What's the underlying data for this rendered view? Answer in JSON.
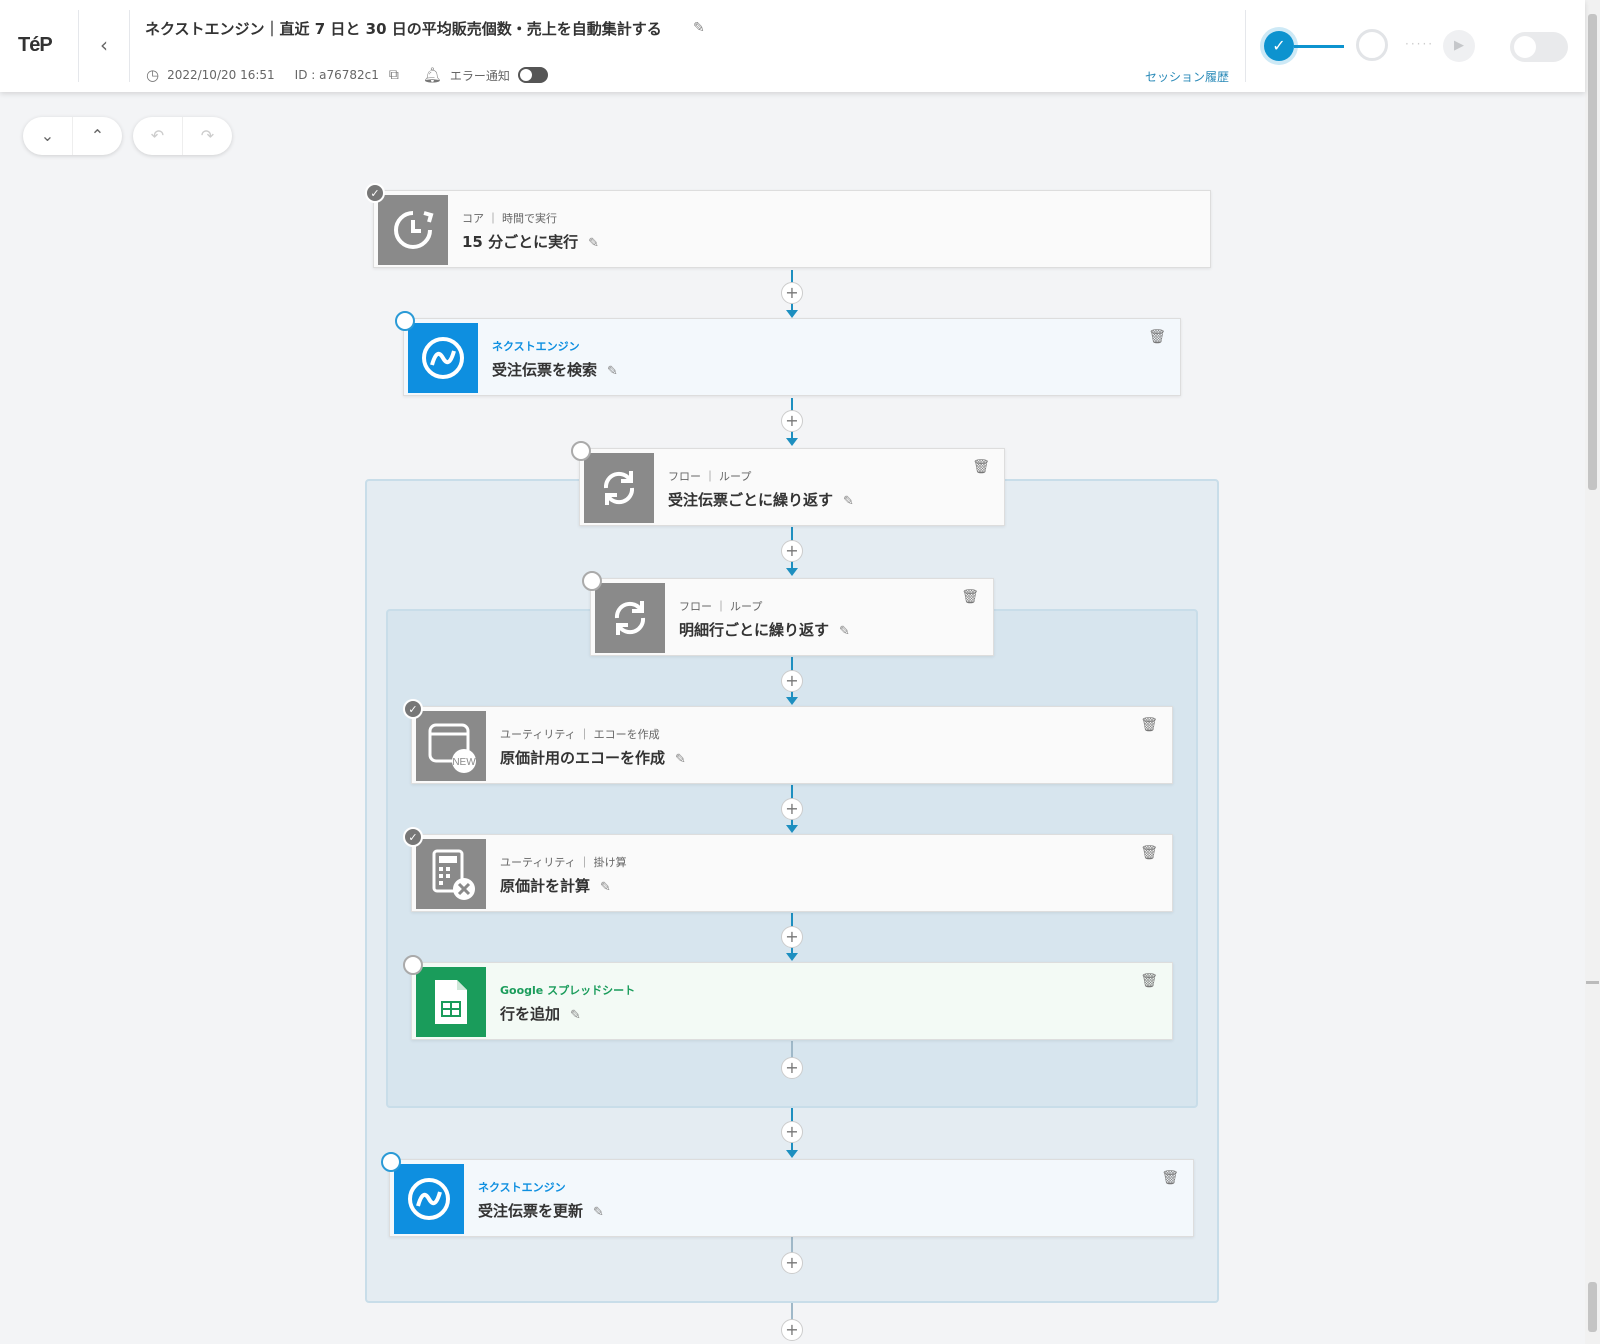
{
  "header": {
    "logo": "TéP",
    "back_icon": "‹",
    "title": "ネクストエンジン｜直近 7 日と 30 日の平均販売個数・売上を自動集計する",
    "datetime": "2022/10/20 16:51",
    "id_label": "ID : a76782c1",
    "error_notify_label": "エラー通知",
    "session_history": "セッション履歴",
    "step1_check": "✓",
    "play_icon": "▶"
  },
  "toolbar": {
    "collapse_icon": "⌄",
    "expand_icon": "⌃",
    "undo_icon": "↶",
    "redo_icon": "↷"
  },
  "flow": {
    "plus": "+",
    "pen": "✎",
    "trash": "🗑",
    "cards": [
      {
        "category": "コア ｜ 時間で実行",
        "name": "15 分ごとに実行",
        "icon": "clock-icon",
        "status": "done"
      },
      {
        "category": "ネクストエンジン",
        "name": "受注伝票を検索",
        "icon": "nextengine-icon",
        "status": "pending"
      },
      {
        "category": "フロー ｜ ループ",
        "name": "受注伝票ごとに繰り返す",
        "icon": "loop-icon",
        "status": "pending"
      },
      {
        "category": "フロー ｜ ループ",
        "name": "明細行ごとに繰り返す",
        "icon": "loop-icon",
        "status": "pending"
      },
      {
        "category": "ユーティリティ ｜ エコーを作成",
        "name": "原価計用のエコーを作成",
        "icon": "new-echo-icon",
        "status": "done"
      },
      {
        "category": "ユーティリティ ｜ 掛け算",
        "name": "原価計を計算",
        "icon": "calculator-icon",
        "status": "done"
      },
      {
        "category": "Google スプレッドシート",
        "name": "行を追加",
        "icon": "google-sheets-icon",
        "status": "pending"
      },
      {
        "category": "ネクストエンジン",
        "name": "受注伝票を更新",
        "icon": "nextengine-icon",
        "status": "pending"
      }
    ]
  },
  "colors": {
    "accent": "#0d93cf",
    "nextengine": "#0e8fe0",
    "sheets": "#1a9c5b",
    "gray_icon": "#8a8a8a"
  }
}
